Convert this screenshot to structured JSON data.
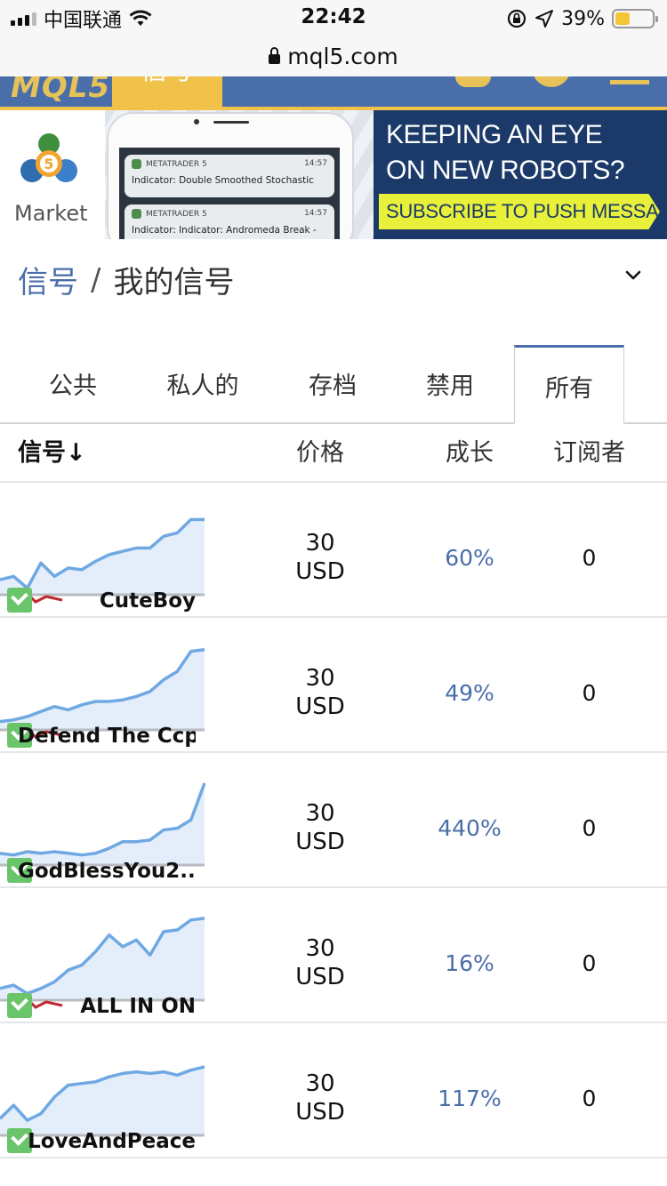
{
  "status_bar": {
    "carrier": "中国联通",
    "time": "22:42",
    "battery": "39%",
    "battery_level": 0.39
  },
  "url_bar": {
    "domain": "mql5.com"
  },
  "site_header": {
    "logo": "MQL5",
    "active_tab": "信号"
  },
  "banner": {
    "market_label": "Market",
    "headline_line1": "KEEPING AN EYE",
    "headline_line2": "ON NEW ROBOTS?",
    "cta": "SUBSCRIBE TO PUSH MESSAGES",
    "notifications": [
      {
        "app": "METATRADER 5",
        "time": "14:57",
        "text": "Indicator: Double Smoothed Stochastic"
      },
      {
        "app": "METATRADER 5",
        "time": "14:57",
        "text": "Indicator: Indicator: Andromeda Break -"
      }
    ]
  },
  "breadcrumb": {
    "link": "信号",
    "separator": "/",
    "current": "我的信号"
  },
  "tabs": [
    {
      "label": "公共",
      "active": false
    },
    {
      "label": "私人的",
      "active": false
    },
    {
      "label": "存档",
      "active": false
    },
    {
      "label": "禁用",
      "active": false
    },
    {
      "label": "所有",
      "active": true
    }
  ],
  "table": {
    "headers": {
      "signal": "信号↓",
      "price": "价格",
      "growth": "成长",
      "subscribers": "订阅者"
    },
    "rows": [
      {
        "name": "CuteBoy",
        "price_amount": "30",
        "price_currency": "USD",
        "growth": "60%",
        "subscribers": "0",
        "spark": [
          0.18,
          0.22,
          0.08,
          0.38,
          0.22,
          0.32,
          0.3,
          0.4,
          0.48,
          0.52,
          0.56,
          0.56,
          0.7,
          0.74,
          0.9,
          0.9
        ],
        "dip": true
      },
      {
        "name": "Defend The Ccp",
        "price_amount": "30",
        "price_currency": "USD",
        "growth": "49%",
        "subscribers": "0",
        "spark": [
          0.1,
          0.12,
          0.16,
          0.22,
          0.28,
          0.24,
          0.3,
          0.34,
          0.34,
          0.36,
          0.4,
          0.46,
          0.6,
          0.7,
          0.94,
          0.96
        ],
        "dip": true
      },
      {
        "name": "GodBlessYou2...",
        "price_amount": "30",
        "price_currency": "USD",
        "growth": "440%",
        "subscribers": "0",
        "spark": [
          0.14,
          0.12,
          0.16,
          0.14,
          0.16,
          0.14,
          0.12,
          0.14,
          0.2,
          0.28,
          0.28,
          0.3,
          0.42,
          0.44,
          0.54,
          0.98
        ],
        "dip": false
      },
      {
        "name": "ALL IN ON",
        "price_amount": "30",
        "price_currency": "USD",
        "growth": "16%",
        "subscribers": "0",
        "spark": [
          0.14,
          0.18,
          0.08,
          0.14,
          0.22,
          0.36,
          0.42,
          0.58,
          0.78,
          0.64,
          0.72,
          0.54,
          0.82,
          0.84,
          0.96,
          0.98
        ],
        "dip": true
      },
      {
        "name": "LoveAndPeace",
        "price_amount": "30",
        "price_currency": "USD",
        "growth": "117%",
        "subscribers": "0",
        "spark": [
          0.2,
          0.36,
          0.18,
          0.26,
          0.46,
          0.6,
          0.62,
          0.64,
          0.7,
          0.74,
          0.76,
          0.74,
          0.76,
          0.72,
          0.78,
          0.82
        ],
        "dip": false
      }
    ]
  }
}
